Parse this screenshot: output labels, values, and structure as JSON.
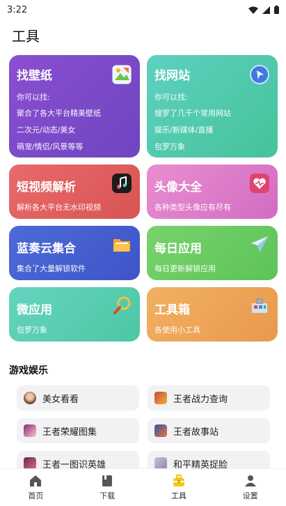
{
  "status": {
    "time": "3:22"
  },
  "page": {
    "title": "工具"
  },
  "cards": [
    {
      "title": "找壁纸",
      "lines": [
        "你可以找:",
        "聚合了各大平台精美壁纸",
        "二次元/动态/美女",
        "萌宠/情侣/风景等等"
      ],
      "icon": "wallpaper-icon"
    },
    {
      "title": "找网站",
      "lines": [
        "你可以找:",
        "搜罗了几千个常用网站",
        "娱乐/新媒体/直播",
        "包罗万象"
      ],
      "icon": "compass-icon"
    },
    {
      "title": "短视频解析",
      "lines": [
        "解析各大平台无水印视频"
      ],
      "icon": "music-note-icon"
    },
    {
      "title": "头像大全",
      "lines": [
        "各种类型头像应有尽有"
      ],
      "icon": "heart-avatar-icon"
    },
    {
      "title": "蓝奏云集合",
      "lines": [
        "集合了大量解锁软件"
      ],
      "icon": "folder-icon"
    },
    {
      "title": "每日应用",
      "lines": [
        "每日更新解锁应用"
      ],
      "icon": "paper-plane-icon"
    },
    {
      "title": "微应用",
      "lines": [
        "包罗万象"
      ],
      "icon": "magnifier-icon"
    },
    {
      "title": "工具箱",
      "lines": [
        "各使用小工具"
      ],
      "icon": "toolbox-icon"
    }
  ],
  "section": {
    "title": "游戏娱乐"
  },
  "games": [
    {
      "label": "美女看看"
    },
    {
      "label": "王者战力查询"
    },
    {
      "label": "王者荣耀图集"
    },
    {
      "label": "王者故事站"
    },
    {
      "label": "王者一图识英雄"
    },
    {
      "label": "和平精英捉脸"
    }
  ],
  "tabs": [
    {
      "label": "首页",
      "icon": "home-icon"
    },
    {
      "label": "下载",
      "icon": "download-icon"
    },
    {
      "label": "工具",
      "icon": "toolbox-tab-icon"
    },
    {
      "label": "设置",
      "icon": "person-icon"
    }
  ]
}
